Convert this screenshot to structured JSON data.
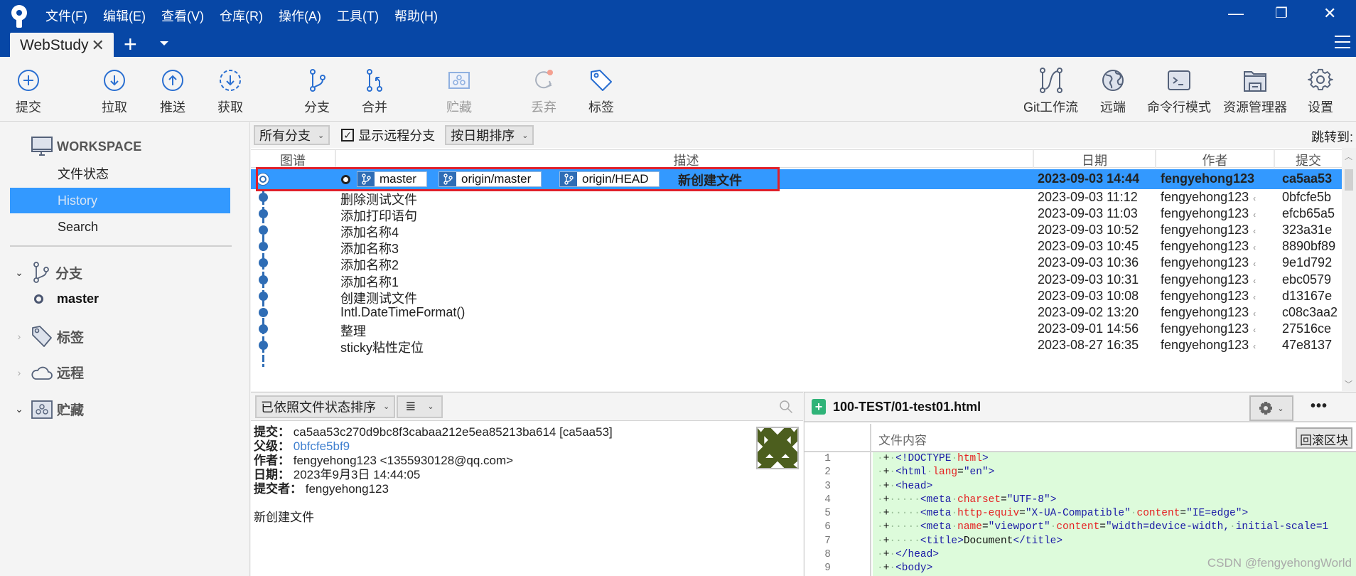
{
  "window": {
    "menu": [
      "文件(F)",
      "编辑(E)",
      "查看(V)",
      "仓库(R)",
      "操作(A)",
      "工具(T)",
      "帮助(H)"
    ],
    "tab_label": "WebStudy",
    "controls": {
      "minimize": "—",
      "restore": "❐",
      "close": "✕"
    }
  },
  "toolbar": {
    "commit": "提交",
    "pull": "拉取",
    "push": "推送",
    "fetch": "获取",
    "branch": "分支",
    "merge": "合并",
    "stash": "贮藏",
    "discard": "丢弃",
    "tag": "标签",
    "git_flow": "Git工作流",
    "remote": "远端",
    "terminal": "命令行模式",
    "explorer": "资源管理器",
    "settings": "设置"
  },
  "sidebar": {
    "workspace": "WORKSPACE",
    "items": [
      {
        "label": "文件状态",
        "active": false
      },
      {
        "label": "History",
        "active": true
      },
      {
        "label": "Search",
        "active": false
      }
    ],
    "groups": {
      "branches": "分支",
      "tags": "标签",
      "remotes": "远程",
      "stashes": "贮藏"
    },
    "current_branch": "master"
  },
  "filters": {
    "branch_filter": "所有分支",
    "show_remote_label": "显示远程分支",
    "show_remote_checked": true,
    "sort": "按日期排序",
    "jump_to": "跳转到:"
  },
  "columns": {
    "graph": "图谱",
    "description": "描述",
    "date": "日期",
    "author": "作者",
    "commit": "提交"
  },
  "commits": [
    {
      "desc": "新创建文件",
      "date": "2023-09-03 14:44",
      "author": "fengyehong123",
      "hash": "ca5aa53",
      "selected": true,
      "refs": [
        "master",
        "origin/master",
        "origin/HEAD"
      ]
    },
    {
      "desc": "删除测试文件",
      "date": "2023-09-03 11:12",
      "author": "fengyehong123",
      "hash": "0bfcfe5b"
    },
    {
      "desc": "添加打印语句",
      "date": "2023-09-03 11:03",
      "author": "fengyehong123",
      "hash": "efcb65a5"
    },
    {
      "desc": "添加名称4",
      "date": "2023-09-03 10:52",
      "author": "fengyehong123",
      "hash": "323a31e"
    },
    {
      "desc": "添加名称3",
      "date": "2023-09-03 10:45",
      "author": "fengyehong123",
      "hash": "8890bf89"
    },
    {
      "desc": "添加名称2",
      "date": "2023-09-03 10:36",
      "author": "fengyehong123",
      "hash": "9e1d792"
    },
    {
      "desc": "添加名称1",
      "date": "2023-09-03 10:31",
      "author": "fengyehong123",
      "hash": "ebc0579"
    },
    {
      "desc": "创建测试文件",
      "date": "2023-09-03 10:08",
      "author": "fengyehong123",
      "hash": "d13167e"
    },
    {
      "desc": "Intl.DateTimeFormat()",
      "date": "2023-09-02 13:20",
      "author": "fengyehong123",
      "hash": "c08c3aa2"
    },
    {
      "desc": "整理",
      "date": "2023-09-01 14:56",
      "author": "fengyehong123",
      "hash": "27516ce"
    },
    {
      "desc": "sticky粘性定位",
      "date": "2023-08-27 16:35",
      "author": "fengyehong123",
      "hash": "47e8137"
    }
  ],
  "file_list": {
    "sort_label": "已依照文件状态排序",
    "view_icon": "≣"
  },
  "commit_details": {
    "commit_label": "提交：",
    "commit_value": "ca5aa53c270d9bc8f3cabaa212e5ea85213ba614 [ca5aa53]",
    "parent_label": "父级：",
    "parent_value": "0bfcfe5bf9",
    "author_label": "作者：",
    "author_value": "fengyehong123 <1355930128@qq.com>",
    "date_label": "日期：",
    "date_value": "2023年9月3日 14:44:05",
    "committer_label": "提交者：",
    "committer_value": "fengyehong123",
    "message": "新创建文件"
  },
  "diff": {
    "file_name": "100-TEST/01-test01.html",
    "header": "文件内容",
    "revert_label": "回滚区块",
    "lines": [
      {
        "n": "1",
        "indent": "",
        "parts": [
          [
            "tg",
            "<!DOCTYPE"
          ],
          [
            "ws",
            " "
          ],
          [
            "at",
            "html"
          ],
          [
            "tg",
            ">"
          ]
        ]
      },
      {
        "n": "2",
        "indent": "",
        "parts": [
          [
            "tg",
            "<html"
          ],
          [
            "ws",
            " "
          ],
          [
            "at",
            "lang"
          ],
          [
            "tx",
            "="
          ],
          [
            "vl",
            "\"en\""
          ],
          [
            "tg",
            ">"
          ]
        ]
      },
      {
        "n": "3",
        "indent": "",
        "parts": [
          [
            "tg",
            "<head>"
          ]
        ]
      },
      {
        "n": "4",
        "indent": "    ",
        "parts": [
          [
            "tg",
            "<meta"
          ],
          [
            "ws",
            " "
          ],
          [
            "at",
            "charset"
          ],
          [
            "tx",
            "="
          ],
          [
            "vl",
            "\"UTF-8\""
          ],
          [
            "tg",
            ">"
          ]
        ]
      },
      {
        "n": "5",
        "indent": "    ",
        "parts": [
          [
            "tg",
            "<meta"
          ],
          [
            "ws",
            " "
          ],
          [
            "at",
            "http-equiv"
          ],
          [
            "tx",
            "="
          ],
          [
            "vl",
            "\"X-UA-Compatible\""
          ],
          [
            "ws",
            " "
          ],
          [
            "at",
            "content"
          ],
          [
            "tx",
            "="
          ],
          [
            "vl",
            "\"IE=edge\""
          ],
          [
            "tg",
            ">"
          ]
        ]
      },
      {
        "n": "6",
        "indent": "    ",
        "parts": [
          [
            "tg",
            "<meta"
          ],
          [
            "ws",
            " "
          ],
          [
            "at",
            "name"
          ],
          [
            "tx",
            "="
          ],
          [
            "vl",
            "\"viewport\""
          ],
          [
            "ws",
            " "
          ],
          [
            "at",
            "content"
          ],
          [
            "tx",
            "="
          ],
          [
            "vl",
            "\"width=device-width,"
          ],
          [
            "ws",
            " "
          ],
          [
            "vl",
            "initial-scale=1"
          ]
        ]
      },
      {
        "n": "7",
        "indent": "    ",
        "parts": [
          [
            "tg",
            "<title>"
          ],
          [
            "tx",
            "Document"
          ],
          [
            "tg",
            "</title>"
          ]
        ]
      },
      {
        "n": "8",
        "indent": "",
        "parts": [
          [
            "tg",
            "</head>"
          ]
        ]
      },
      {
        "n": "9",
        "indent": "",
        "parts": [
          [
            "tg",
            "<body>"
          ]
        ]
      }
    ]
  },
  "watermark": "CSDN @fengyehongWorld",
  "colors": {
    "titlebar": "#0747a6",
    "selection": "#3399ff",
    "graph": "#2f6db5",
    "diff_added": "#ddfbdb",
    "highlight_frame": "#e0202a"
  }
}
